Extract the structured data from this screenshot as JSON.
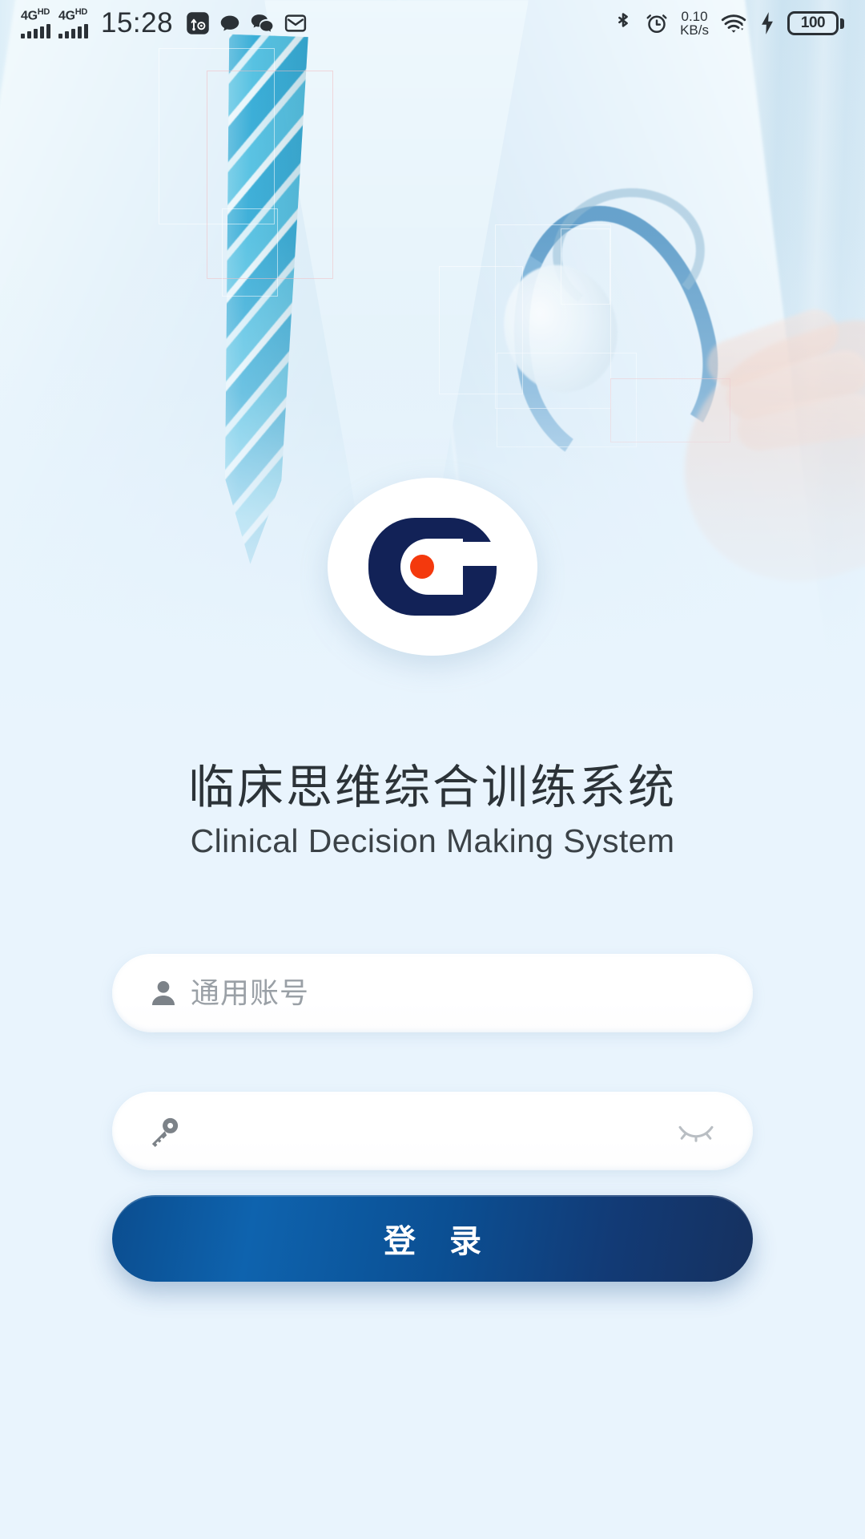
{
  "status_bar": {
    "network_left": {
      "tech": "4G",
      "suffix": "HD",
      "bars": 5
    },
    "network_right": {
      "tech": "4G",
      "suffix": "HD",
      "bars": 5
    },
    "time": "15:28",
    "left_icons": [
      "usb-settings-icon",
      "message-bubble-icon",
      "wechat-icon",
      "mail-icon"
    ],
    "bluetooth_icon": "bluetooth-icon",
    "alarm_icon": "alarm-clock-icon",
    "network_speed": {
      "value": "0.10",
      "unit": "KB/s"
    },
    "wifi_icon": "wifi-icon",
    "charging_icon": "lightning-bolt-icon",
    "battery_level": "100"
  },
  "brand": {
    "logo_icon": "clinical-c-logo",
    "logo_colors": {
      "mark": "#122257",
      "dot": "#f4390d",
      "disc": "#ffffff"
    },
    "title_cn": "临床思维综合训练系统",
    "title_en": "Clinical Decision Making System"
  },
  "form": {
    "username": {
      "icon": "user-icon",
      "value": "",
      "placeholder": "通用账号"
    },
    "password": {
      "icon": "key-icon",
      "value": "",
      "placeholder": "",
      "toggle_icon": "eye-off-icon"
    },
    "submit_label": "登 录",
    "accent_color": "#0e63ae"
  },
  "background": {
    "theme_color": "#e9f4fd",
    "description_icons": [
      "doctor-coat",
      "blue-striped-tie",
      "stethoscope",
      "hand"
    ]
  }
}
